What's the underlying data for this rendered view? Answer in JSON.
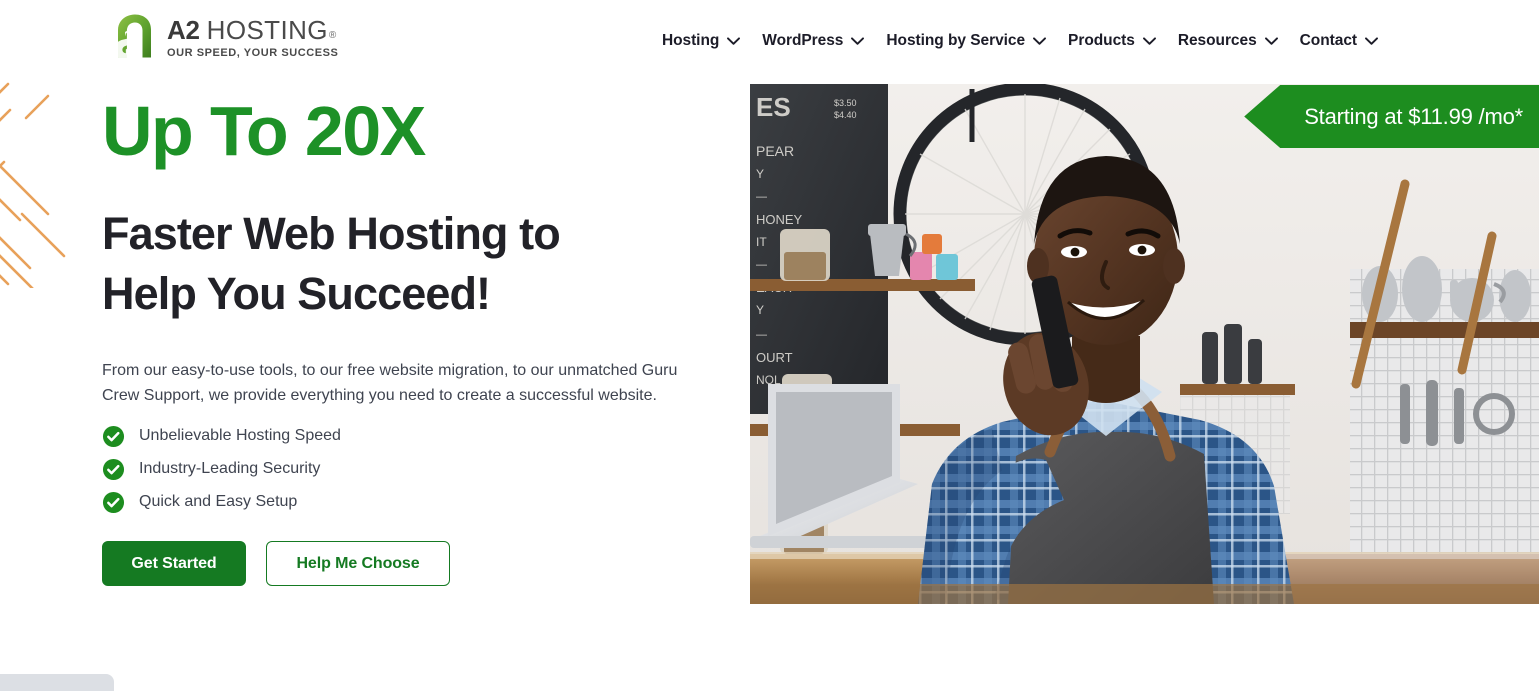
{
  "brand": {
    "logo_icon": "a2-logo-mark",
    "name_bold": "A2",
    "name_light": "HOSTING",
    "registered_mark": "®",
    "tagline": "OUR SPEED, YOUR SUCCESS",
    "green": "#1d9127",
    "dark_green": "#157a22",
    "banner_green": "#1d8d1f",
    "text_dark": "#222228",
    "body_gray": "#3f4450",
    "accent_orange": "#e8a15a"
  },
  "nav": {
    "items": [
      {
        "label": "Hosting",
        "caret_icon": "chevron-down-icon"
      },
      {
        "label": "WordPress",
        "caret_icon": "chevron-down-icon"
      },
      {
        "label": "Hosting by Service",
        "caret_icon": "chevron-down-icon"
      },
      {
        "label": "Products",
        "caret_icon": "chevron-down-icon"
      },
      {
        "label": "Resources",
        "caret_icon": "chevron-down-icon"
      },
      {
        "label": "Contact",
        "caret_icon": "chevron-down-icon"
      }
    ]
  },
  "hero": {
    "headline_accent": "Up To 20X",
    "headline_line1": "Faster Web Hosting to",
    "headline_line2": "Help You Succeed!",
    "body": "From our easy-to-use tools, to our free website migration, to our unmatched Guru Crew Support, we provide everything you need to create a successful website.",
    "features": [
      {
        "icon": "check-circle-icon",
        "label": "Unbelievable Hosting Speed"
      },
      {
        "icon": "check-circle-icon",
        "label": "Industry-Leading Security"
      },
      {
        "icon": "check-circle-icon",
        "label": "Quick and Easy Setup"
      }
    ],
    "primary_cta": "Get Started",
    "secondary_cta": "Help Me Choose",
    "price_banner": "Starting at $11.99 /mo*",
    "image_alt": "Smiling man in blue plaid shirt and gray apron talking on a mobile phone behind a cafe counter"
  },
  "decor": {
    "diagonal_lines_icon": "diagonal-stripes-decoration",
    "download_shelf_icon": "download-shelf"
  }
}
